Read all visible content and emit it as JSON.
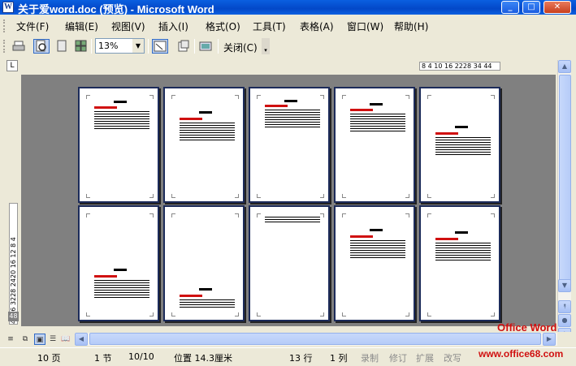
{
  "window": {
    "title": "关于爱word.doc (预览) - Microsoft Word",
    "icon": "W",
    "controls": {
      "minimize": "_",
      "maximize": "□",
      "close": "✕"
    }
  },
  "menu": {
    "items": [
      {
        "label": "文件(F)"
      },
      {
        "label": "编辑(E)"
      },
      {
        "label": "视图(V)"
      },
      {
        "label": "插入(I)"
      },
      {
        "label": "格式(O)"
      },
      {
        "label": "工具(T)"
      },
      {
        "label": "表格(A)"
      },
      {
        "label": "窗口(W)"
      },
      {
        "label": "帮助(H)"
      }
    ]
  },
  "toolbar": {
    "zoom_value": "13%",
    "close_label": "关闭(C)",
    "icons": [
      "print-icon",
      "magnifier-icon",
      "one-page-icon",
      "multiple-pages-icon",
      "shrink-to-fit-icon",
      "full-screen-icon"
    ]
  },
  "ruler": {
    "corner": "L",
    "horizontal_text": "8  4  10 16 2228 34  44",
    "vertical_text": "4036 3228 2420 16 12 8 4",
    "bottom_label": "48"
  },
  "preview": {
    "page_count": 10
  },
  "status": {
    "page": "10 页",
    "section": "1 节",
    "page_of": "10/10",
    "position": "位置 14.3厘米",
    "line": "13 行",
    "column": "1 列",
    "rec": "录制",
    "trk": "修订",
    "ext": "扩展",
    "ovr": "改写"
  },
  "watermark": {
    "top": "Office Word",
    "url": "www.office68.com"
  },
  "colors": {
    "titlebar": "#0a5fe0",
    "preview_bg": "#808080",
    "page_border": "#1c2b5a",
    "heading_red": "#d01010"
  }
}
